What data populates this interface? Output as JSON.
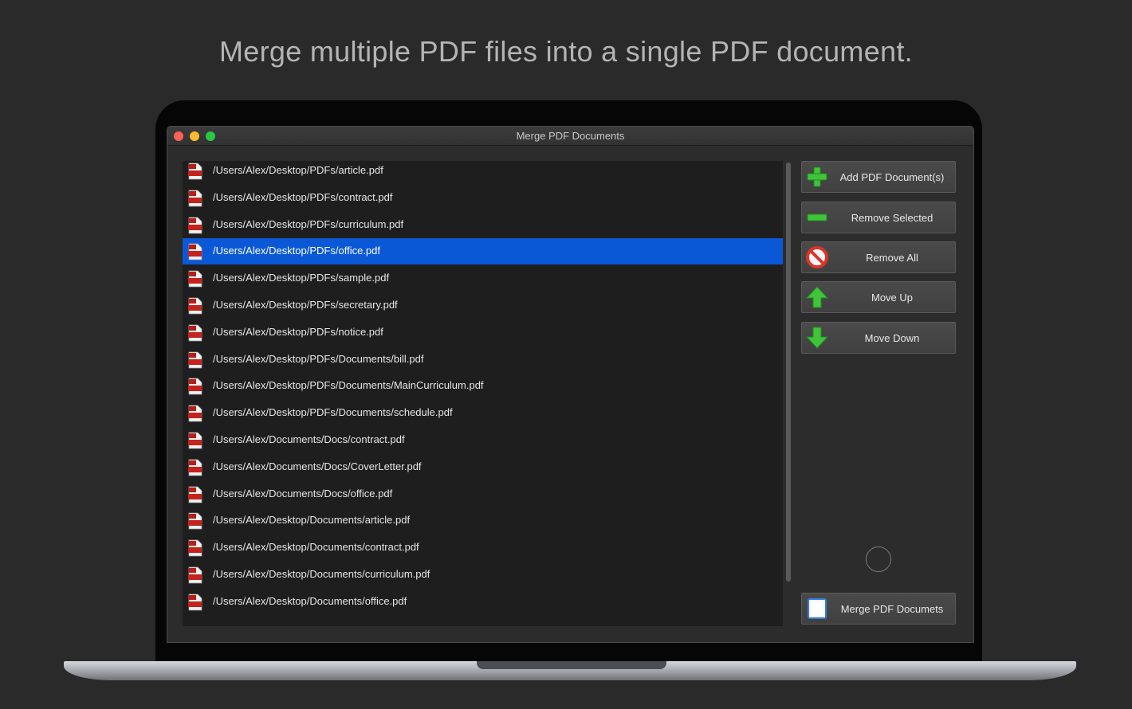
{
  "headline": "Merge multiple PDF files into a single PDF document.",
  "window": {
    "title": "Merge PDF Documents"
  },
  "files": [
    "/Users/Alex/Desktop/PDFs/article.pdf",
    "/Users/Alex/Desktop/PDFs/contract.pdf",
    "/Users/Alex/Desktop/PDFs/curriculum.pdf",
    "/Users/Alex/Desktop/PDFs/office.pdf",
    "/Users/Alex/Desktop/PDFs/sample.pdf",
    "/Users/Alex/Desktop/PDFs/secretary.pdf",
    "/Users/Alex/Desktop/PDFs/notice.pdf",
    "/Users/Alex/Desktop/PDFs/Documents/bill.pdf",
    "/Users/Alex/Desktop/PDFs/Documents/MainCurriculum.pdf",
    "/Users/Alex/Desktop/PDFs/Documents/schedule.pdf",
    "/Users/Alex/Documents/Docs/contract.pdf",
    "/Users/Alex/Documents/Docs/CoverLetter.pdf",
    "/Users/Alex/Documents/Docs/office.pdf",
    "/Users/Alex/Desktop/Documents/article.pdf",
    "/Users/Alex/Desktop/Documents/contract.pdf",
    "/Users/Alex/Desktop/Documents/curriculum.pdf",
    "/Users/Alex/Desktop/Documents/office.pdf"
  ],
  "selected_index": 3,
  "buttons": {
    "add": "Add PDF Document(s)",
    "remove_selected": "Remove Selected",
    "remove_all": "Remove All",
    "move_up": "Move Up",
    "move_down": "Move Down",
    "merge": "Merge PDF Documets"
  },
  "icons": {
    "add": "plus-icon",
    "remove_selected": "minus-icon",
    "remove_all": "prohibited-icon",
    "move_up": "arrow-up-icon",
    "move_down": "arrow-down-icon",
    "merge": "document-icon",
    "file": "pdf-file-icon"
  },
  "colors": {
    "selection": "#0a58d6",
    "green_icon": "#3fc43a",
    "red_icon": "#d9342b"
  }
}
